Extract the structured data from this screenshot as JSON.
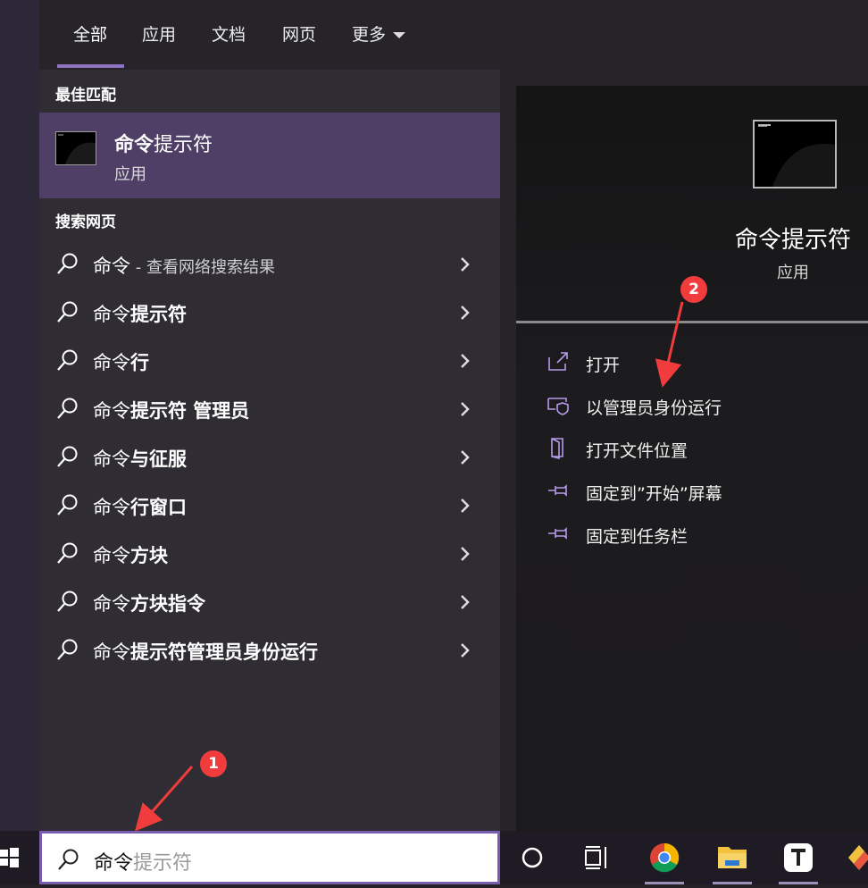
{
  "tabs": [
    {
      "label": "全部"
    },
    {
      "label": "应用"
    },
    {
      "label": "文档"
    },
    {
      "label": "网页"
    },
    {
      "label": "更多"
    }
  ],
  "best_match": {
    "section_title": "最佳匹配",
    "title_bold": "命令",
    "title_rest": "提示符",
    "subtitle": "应用"
  },
  "web_search": {
    "section_title": "搜索网页",
    "items": [
      {
        "prefix": "命令",
        "bold": "",
        "hint": " - 查看网络搜索结果"
      },
      {
        "prefix": "命令",
        "bold": "提示符",
        "hint": ""
      },
      {
        "prefix": "命令",
        "bold": "行",
        "hint": ""
      },
      {
        "prefix": "命令",
        "bold": "提示符 管理员",
        "hint": ""
      },
      {
        "prefix": "命令",
        "bold": "与征服",
        "hint": ""
      },
      {
        "prefix": "命令",
        "bold": "行窗口",
        "hint": ""
      },
      {
        "prefix": "命令",
        "bold": "方块",
        "hint": ""
      },
      {
        "prefix": "命令",
        "bold": "方块指令",
        "hint": ""
      },
      {
        "prefix": "命令",
        "bold": "提示符管理员身份运行",
        "hint": ""
      }
    ]
  },
  "preview": {
    "title": "命令提示符",
    "subtitle": "应用",
    "actions": [
      {
        "label": "打开",
        "icon": "open-icon"
      },
      {
        "label": "以管理员身份运行",
        "icon": "shield-icon"
      },
      {
        "label": "打开文件位置",
        "icon": "file-location-icon"
      },
      {
        "label": "固定到”开始”屏幕",
        "icon": "pin-icon"
      },
      {
        "label": "固定到任务栏",
        "icon": "pin-icon"
      }
    ]
  },
  "annotations": [
    {
      "number": "1"
    },
    {
      "number": "2"
    }
  ],
  "search": {
    "typed": "命令",
    "suggestion": "提示符"
  },
  "colors": {
    "accent": "#8c72c0",
    "best_match_bg": "#4f3f66",
    "marker": "#f03c3c"
  }
}
